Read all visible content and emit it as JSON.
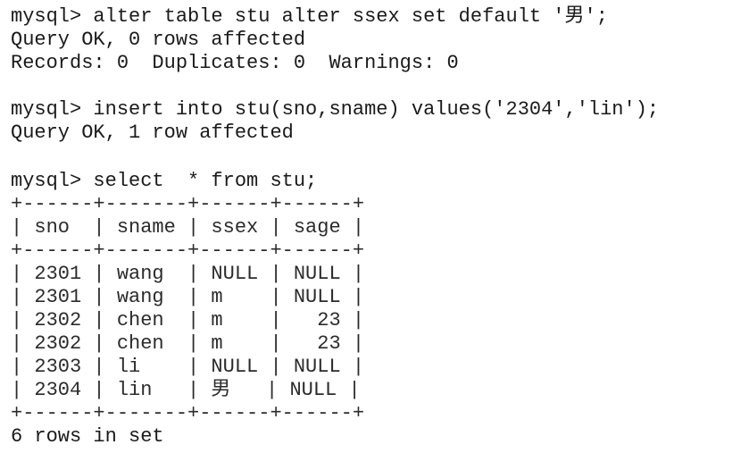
{
  "session": {
    "lines": [
      "mysql> alter table stu alter ssex set default '男';",
      "Query OK, 0 rows affected",
      "Records: 0  Duplicates: 0  Warnings: 0",
      "mysql> insert into stu(sno,sname) values('2304','lin');",
      "Query OK, 1 row affected",
      "mysql> select  * from stu;",
      "+------+-------+------+------+",
      "| sno  | sname | ssex | sage |",
      "+------+-------+------+------+",
      "| 2301 | wang  | NULL | NULL |",
      "| 2301 | wang  | m    | NULL |",
      "| 2302 | chen  | m    |   23 |",
      "| 2302 | chen  | m    |   23 |",
      "| 2303 | li    | NULL | NULL |",
      "| 2304 | lin   | 男   | NULL |",
      "+------+-------+------+------+",
      "6 rows in set"
    ]
  }
}
